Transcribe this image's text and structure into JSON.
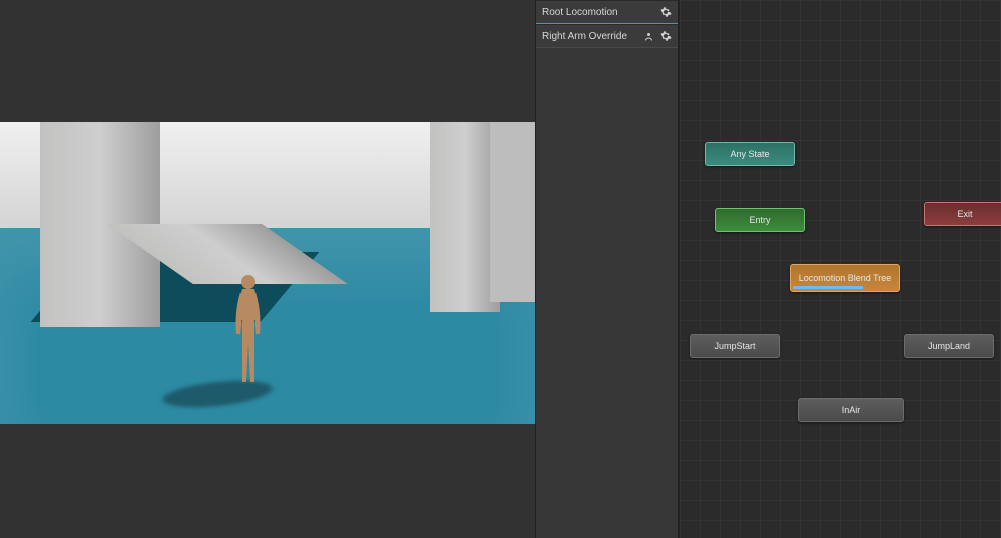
{
  "layers": {
    "items": [
      {
        "label": "Root Locomotion",
        "showMask": false
      },
      {
        "label": "Right Arm Override",
        "showMask": true
      }
    ]
  },
  "graph": {
    "nodes": {
      "anyState": {
        "label": "Any State"
      },
      "entry": {
        "label": "Entry"
      },
      "exit": {
        "label": "Exit"
      },
      "blendTree": {
        "label": "Locomotion Blend Tree"
      },
      "jumpStart": {
        "label": "JumpStart"
      },
      "jumpLand": {
        "label": "JumpLand"
      },
      "inAir": {
        "label": "InAir"
      }
    }
  }
}
